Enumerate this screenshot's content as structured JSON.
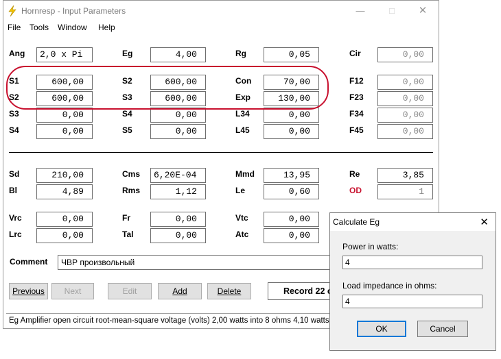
{
  "window": {
    "title": "Hornresp - Input Parameters",
    "menu": [
      "File",
      "Tools",
      "Window",
      "Help"
    ]
  },
  "colors": {
    "accent_icon": "#f2c200",
    "highlight_ring": "#c8102e",
    "od_label": "#c8102e",
    "default_button_border": "#0078d7"
  },
  "params": {
    "Ang": "2,0 x Pi",
    "Eg": "4,00",
    "Rg": "0,05",
    "Cir": "0,00",
    "S1": "600,00",
    "S2_b": "600,00",
    "Con": "70,00",
    "F12": "0,00",
    "S2": "600,00",
    "S3_b": "600,00",
    "Exp": "130,00",
    "F23": "0,00",
    "S3": "0,00",
    "S4_b": "0,00",
    "L34": "0,00",
    "F34": "0,00",
    "S4": "0,00",
    "S5": "0,00",
    "L45": "0,00",
    "F45": "0,00",
    "Sd": "210,00",
    "Cms": "6,20E-04",
    "Mmd": "13,95",
    "Re": "3,85",
    "Bl": "4,89",
    "Rms": "1,12",
    "Le": "0,60",
    "OD": "1",
    "Vrc": "0,00",
    "Fr": "0,00",
    "Vtc": "0,00",
    "Lrc": "0,00",
    "Tal": "0,00",
    "Atc": "0,00"
  },
  "labels": {
    "Ang": "Ang",
    "Eg": "Eg",
    "Rg": "Rg",
    "Cir": "Cir",
    "S1": "S1",
    "S2_b": "S2",
    "Con": "Con",
    "F12": "F12",
    "S2": "S2",
    "S3_b": "S3",
    "Exp": "Exp",
    "F23": "F23",
    "S3": "S3",
    "S4_b": "S4",
    "L34": "L34",
    "F34": "F34",
    "S4": "S4",
    "S5": "S5",
    "L45": "L45",
    "F45": "F45",
    "Sd": "Sd",
    "Cms": "Cms",
    "Mmd": "Mmd",
    "Re": "Re",
    "Bl": "Bl",
    "Rms": "Rms",
    "Le": "Le",
    "OD": "OD",
    "Vrc": "Vrc",
    "Fr": "Fr",
    "Vtc": "Vtc",
    "Lrc": "Lrc",
    "Tal": "Tal",
    "Atc": "Atc",
    "comment": "Comment"
  },
  "comment_value": "ЧВР произвольный",
  "buttons": {
    "previous": "Previous",
    "next": "Next",
    "edit": "Edit",
    "add": "Add",
    "delete": "Delete",
    "record": "Record 22 of"
  },
  "status": "Eg  Amplifier open circuit root-mean-square voltage  (volts)   2,00 watts into 8 ohms   4,10 watts into 4 ohms",
  "dialog": {
    "title": "Calculate Eg",
    "power_label": "Power in watts:",
    "power_value": "4",
    "load_label": "Load impedance in ohms:",
    "load_value": "4",
    "ok": "OK",
    "cancel": "Cancel"
  }
}
